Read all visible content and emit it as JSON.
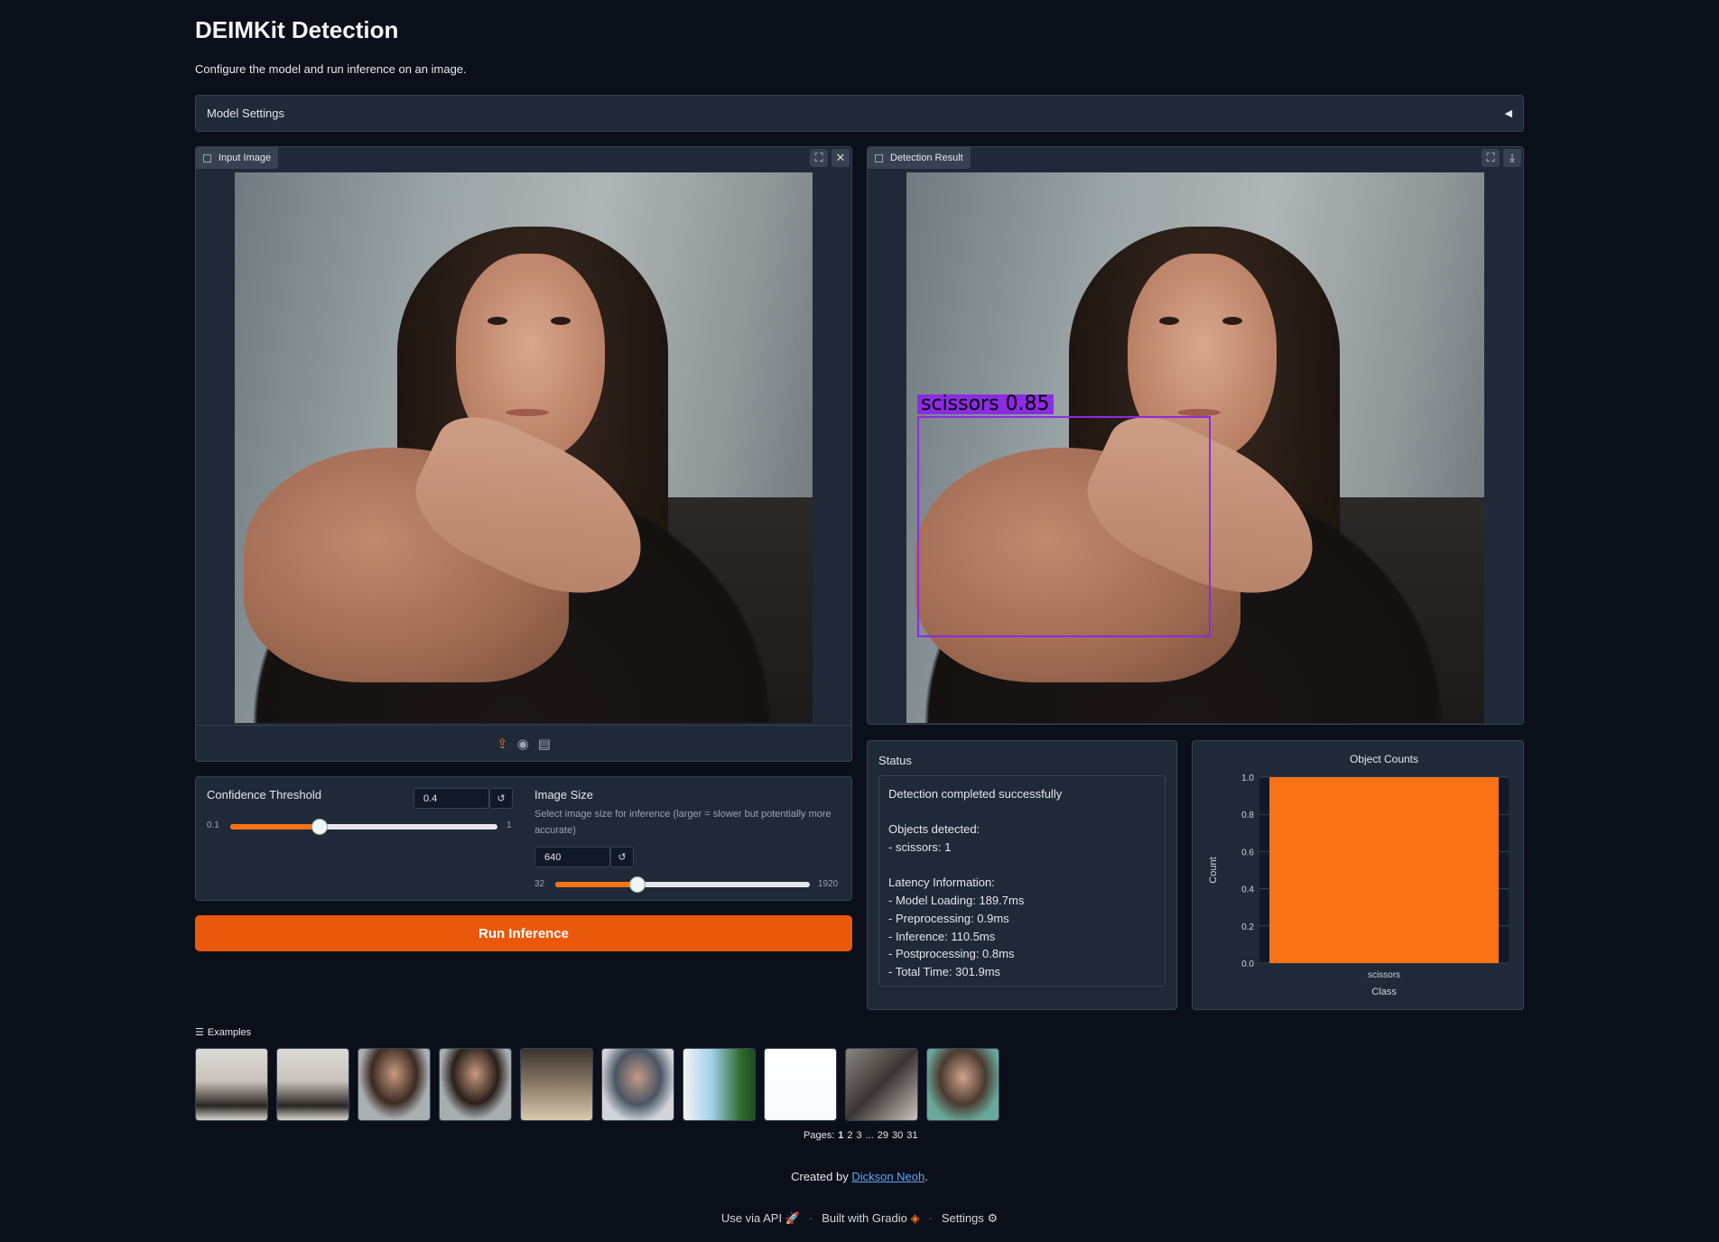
{
  "title": "DEIMKit Detection",
  "subtitle": "Configure the model and run inference on an image.",
  "model_settings": {
    "label": "Model Settings",
    "state_icon": "triangle-left"
  },
  "input_image": {
    "label": "Input Image",
    "toolbar_icons": [
      "upload-icon",
      "webcam-icon",
      "clipboard-icon"
    ]
  },
  "detection_result": {
    "label": "Detection Result",
    "box_label": "scissors  0.85",
    "box_color": "#8b2be2"
  },
  "confidence": {
    "label": "Confidence Threshold",
    "value": "0.4",
    "min": "0.1",
    "max": "1",
    "fraction": 0.333,
    "reset": "↺"
  },
  "image_size": {
    "label": "Image Size",
    "info": "Select image size for inference (larger = slower but potentially more accurate)",
    "value": "640",
    "min": "32",
    "max": "1920",
    "fraction": 0.322,
    "reset": "↺"
  },
  "run_button": "Run Inference",
  "status": {
    "label": "Status",
    "lines": [
      "Detection completed successfully",
      "",
      "Objects detected:",
      "- scissors: 1",
      "",
      "Latency Information:",
      "- Model Loading: 189.7ms",
      "- Preprocessing: 0.9ms",
      "- Inference: 110.5ms",
      "- Postprocessing: 0.8ms",
      "- Total Time: 301.9ms"
    ]
  },
  "chart_data": {
    "type": "bar",
    "title": "Object Counts",
    "categories": [
      "scissors"
    ],
    "values": [
      1
    ],
    "xlabel": "Class",
    "ylabel": "Count",
    "ylim": [
      0,
      1
    ],
    "yticks": [
      "0.0",
      "0.2",
      "0.4",
      "0.6",
      "0.8",
      "1.0"
    ],
    "color": "#f97316",
    "grid": true
  },
  "examples": {
    "label": "Examples",
    "count": 10
  },
  "pagination": {
    "prefix": "Pages:",
    "pages": [
      "1",
      "2",
      "3",
      "...",
      "29",
      "30",
      "31"
    ],
    "current": "1"
  },
  "credit": {
    "prefix": "Created by ",
    "link": "Dickson Neoh",
    "suffix": "."
  },
  "footer": {
    "api": "Use via API",
    "built": "Built with Gradio",
    "settings": "Settings"
  },
  "accent": "#f97316"
}
